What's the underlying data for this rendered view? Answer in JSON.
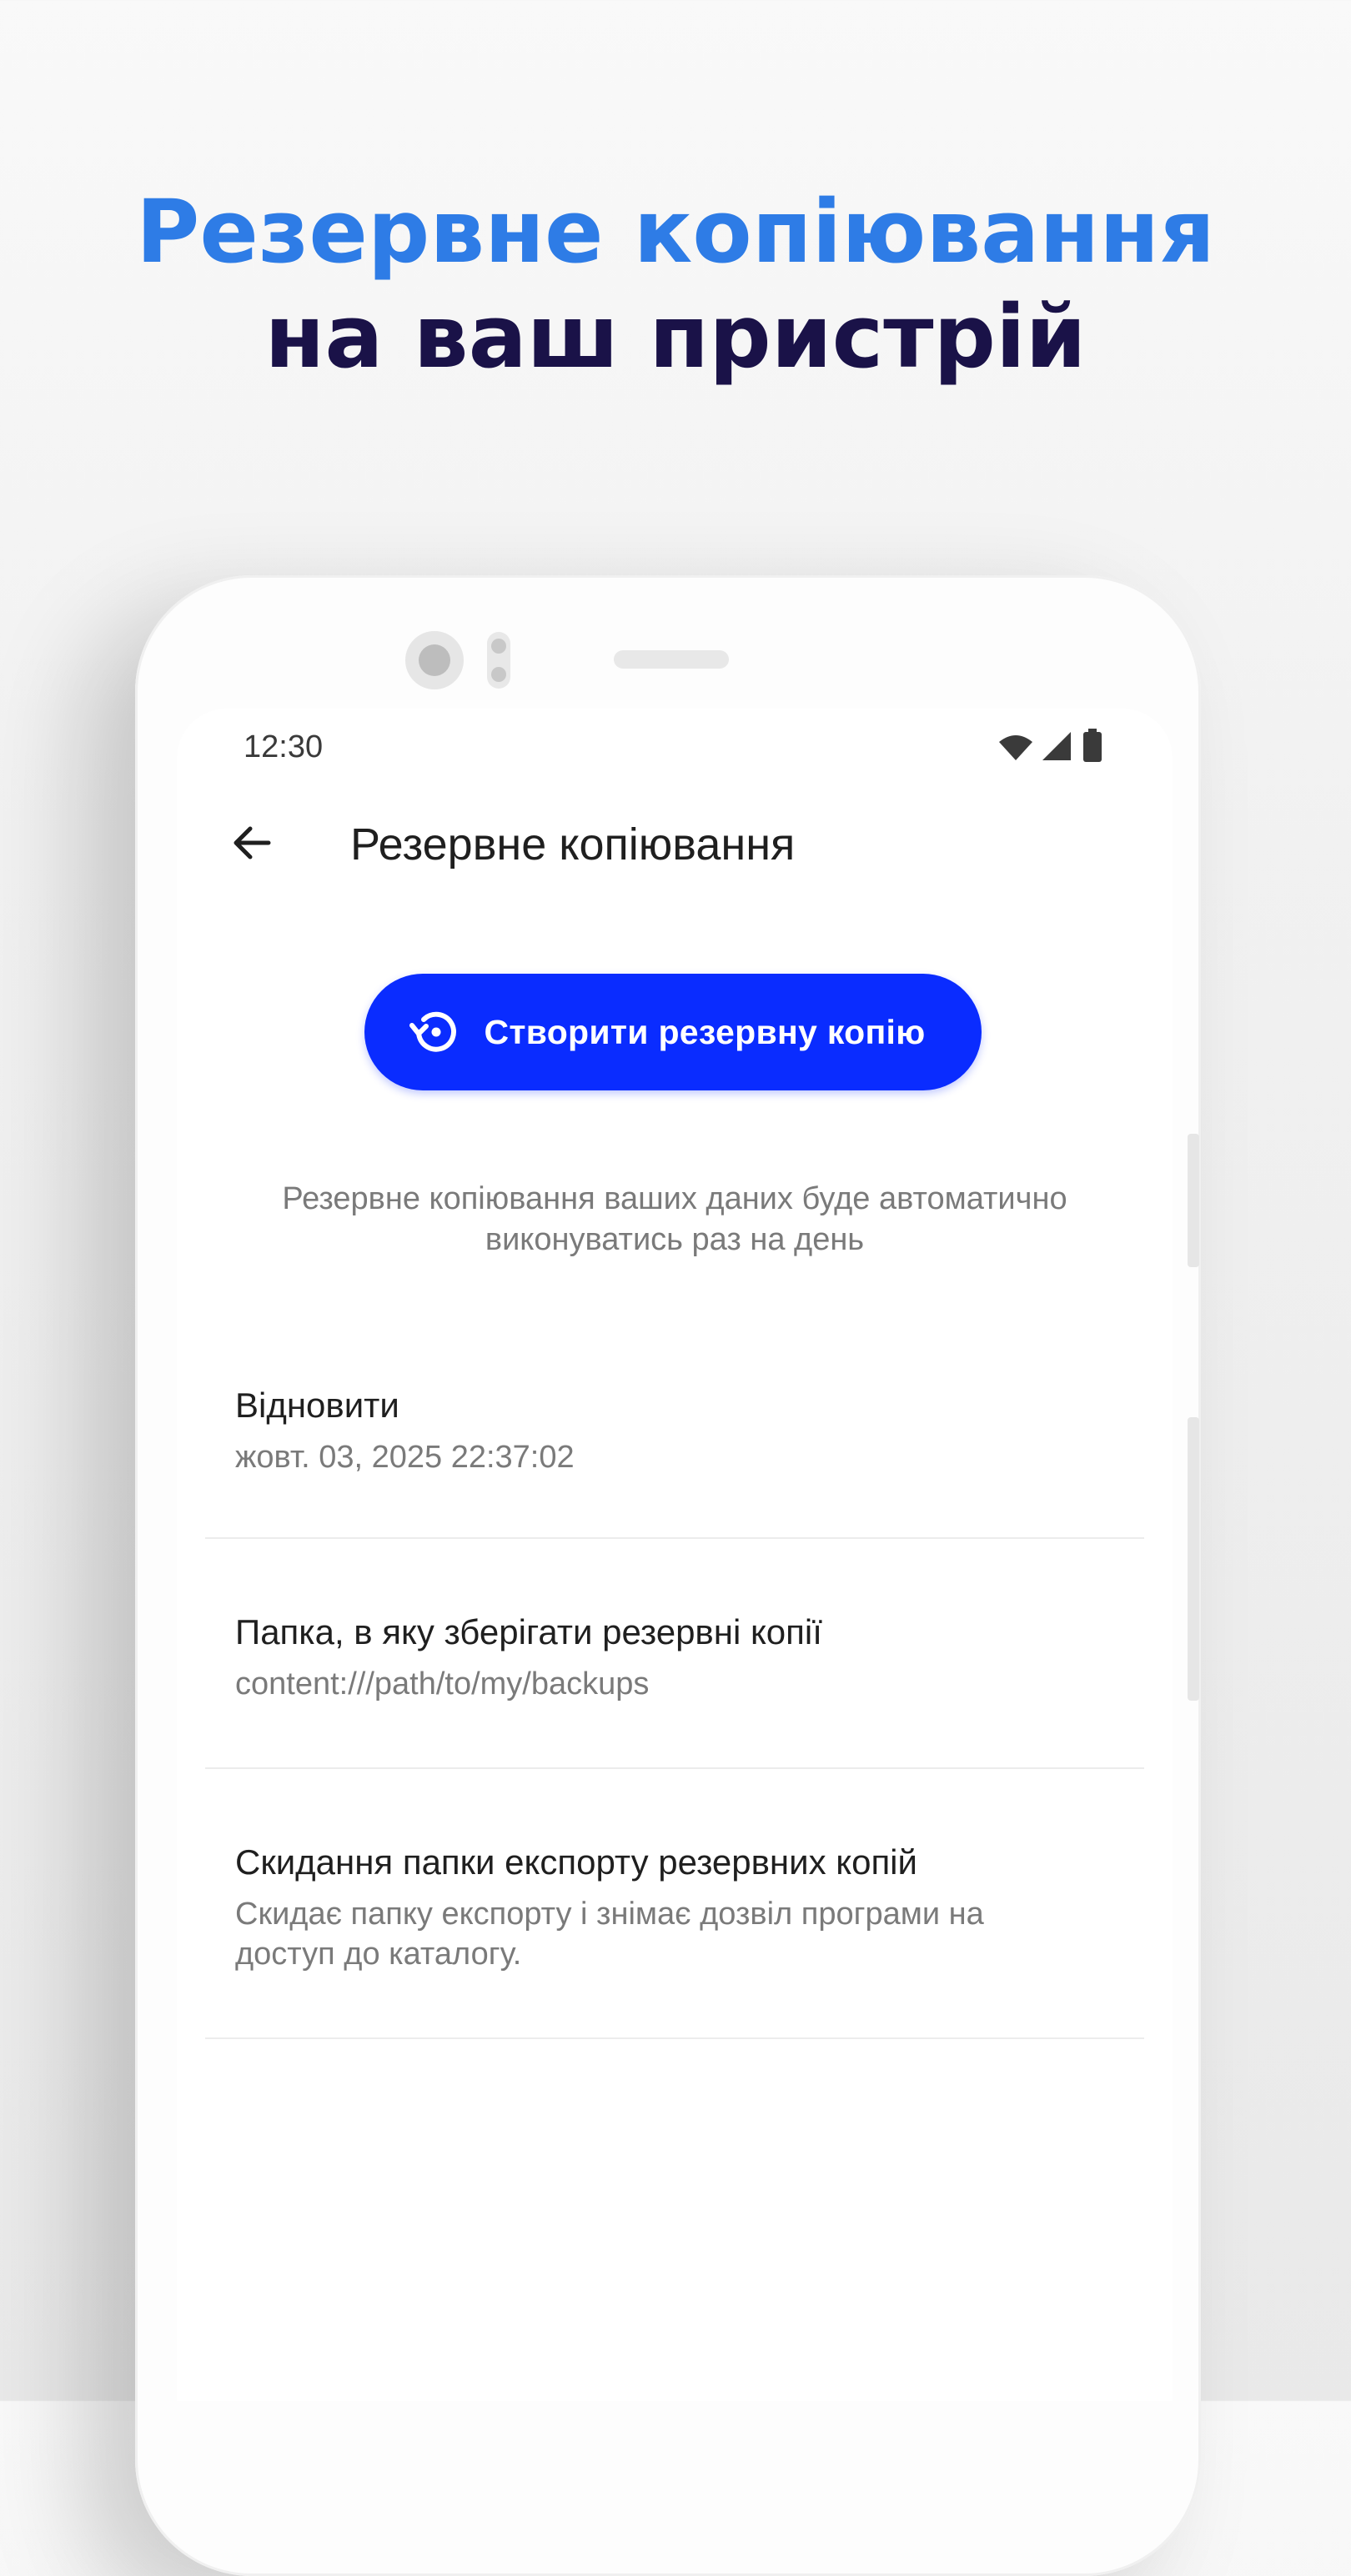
{
  "headline": {
    "line1": "Резервне копіювання",
    "line2": "на ваш пристрій"
  },
  "status_bar": {
    "time": "12:30",
    "icons": [
      "wifi-icon",
      "signal-icon",
      "battery-icon"
    ]
  },
  "app_bar": {
    "back_icon": "arrow-left-icon",
    "title": "Резервне копіювання"
  },
  "backup_button": {
    "icon": "restore-icon",
    "label": "Створити резервну копію"
  },
  "info": {
    "text": "Резервне копіювання ваших даних буде автоматично виконуватись раз на день"
  },
  "settings": [
    {
      "title": "Відновити",
      "subtitle": "жовт. 03, 2025  22:37:02"
    },
    {
      "title": "Папка, в яку зберігати резервні копії",
      "subtitle": "content:///path/to/my/backups"
    },
    {
      "title": "Скидання папки експорту резервних копій",
      "subtitle": "Скидає папку експорту і знімає дозвіл програми на доступ до каталогу."
    }
  ],
  "colors": {
    "headline_accent": "#2e7ce6",
    "headline_dark": "#1a1248",
    "primary_button": "#0a2cff"
  }
}
